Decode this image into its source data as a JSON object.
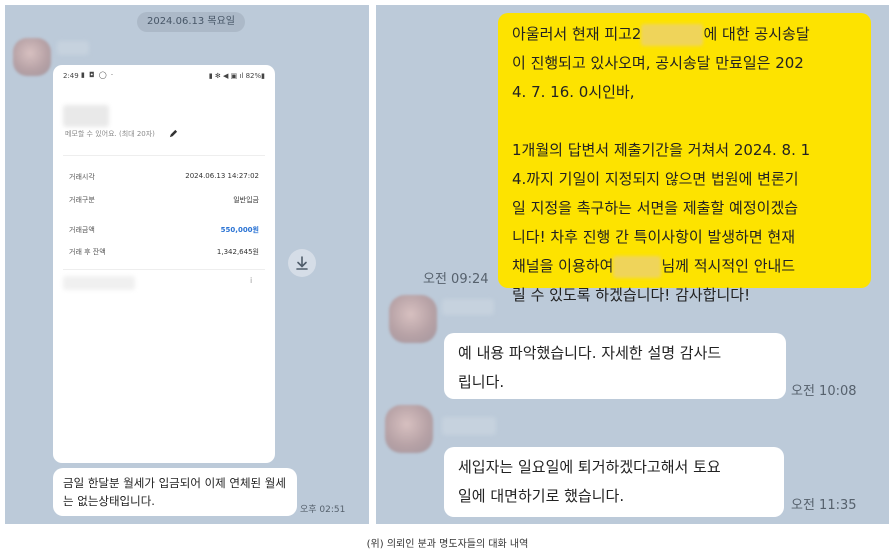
{
  "left": {
    "date": "2024.06.13 목요일",
    "phone": {
      "status_time": "2:49",
      "status_icons": "▮ ◘ ◯ ·",
      "status_right": "▮ ✻ ◀ ▣ ıl 82%▮",
      "memo_placeholder": "메모할 수 있어요. (최대 20자)",
      "rows": [
        {
          "label": "거래시각",
          "value": "2024.06.13 14:27:02"
        },
        {
          "label": "거래구분",
          "value": "일반입금"
        },
        {
          "label": "거래금액",
          "value": "550,000원"
        },
        {
          "label": "거래 후 잔액",
          "value": "1,342,645원"
        }
      ],
      "acct_dot": "i"
    },
    "message": "금일 한달분 월세가 입금되어 이제 연체된 월세는 없는상태입니다.",
    "message_time": "오후 02:51"
  },
  "right": {
    "yellow": {
      "line1_pre": "아울러서 현재 피고2",
      "line1_post": "에 대한 공시송달",
      "line2": "이 진행되고 있사오며, 공시송달 만료일은 202",
      "line3": "4. 7. 16. 0시인바,",
      "line4": "1개월의 답변서 제출기간을 거쳐서 2024. 8. 1",
      "line5": "4.까지 기일이 지정되지 않으면 법원에 변론기",
      "line6": "일 지정을 촉구하는 서면을 제출할 예정이겠습",
      "line7": "니다! 차후 진행 간 특이사항이 발생하면 현재",
      "line8_pre": "채널을 이용하여",
      "line8_post": "님께 적시적인 안내드",
      "line9": "릴 수 있도록 하겠습니다! 감사합니다!",
      "time": "오전 09:24"
    },
    "reply1": {
      "line1": "예 내용 파악했습니다. 자세한 설명 감사드",
      "line2": "립니다.",
      "time": "오전 10:08"
    },
    "reply2": {
      "line1": "세입자는 일요일에 퇴거하겠다고해서 토요",
      "line2": "일에 대면하기로 했습니다.",
      "time": "오전 11:35"
    }
  },
  "caption": "(위) 의뢰인 분과 명도자들의 대화 내역",
  "colors": {
    "chat_bg": "#bccad9",
    "yellow_bubble": "#fde300",
    "amount_blue": "#2c74d4"
  }
}
